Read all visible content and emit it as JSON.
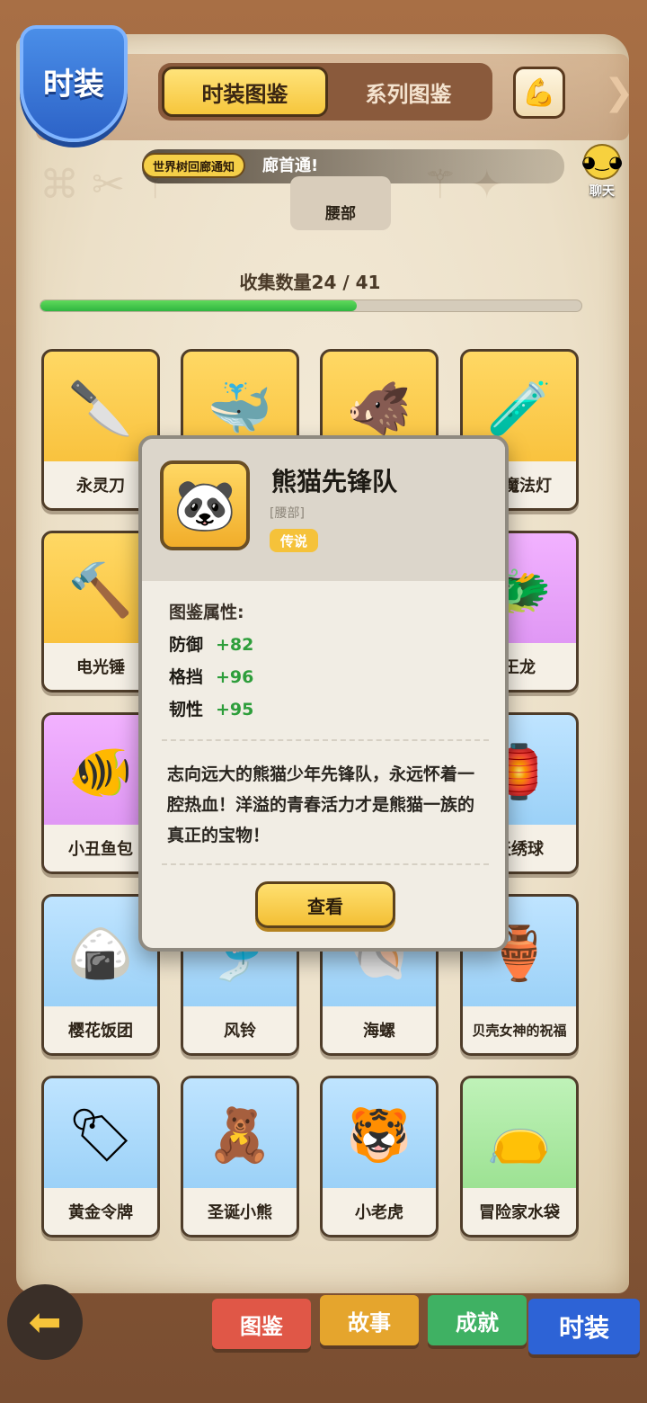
{
  "header": {
    "badge_title": "时装",
    "tabs": [
      {
        "label": "时装图鉴",
        "active": true
      },
      {
        "label": "系列图鉴",
        "active": false
      }
    ],
    "share_icon": "arm-flex-icon",
    "chevron_icon": "chevron-right-icon"
  },
  "notice": {
    "badge": "世界树回廊通知",
    "text": "廊首通!"
  },
  "category_chip": "腰部",
  "chat": {
    "label": "聊天",
    "icon": "chat-bubble-icon"
  },
  "collection": {
    "label": "收集数量24 / 41",
    "collected": 24,
    "total": 41
  },
  "grid": [
    {
      "name": "永灵刀",
      "rarity": "gold",
      "icon": "cleaver-icon"
    },
    {
      "name": "",
      "rarity": "gold",
      "icon": "whale-icon"
    },
    {
      "name": "",
      "rarity": "gold",
      "icon": "boar-icon"
    },
    {
      "name": "龙魔法灯",
      "rarity": "gold",
      "icon": "lamp-bottle-icon"
    },
    {
      "name": "电光锤",
      "rarity": "gold",
      "icon": "hammer-icon"
    },
    {
      "name": "王龙",
      "rarity": "purple",
      "icon": "red-dragon-icon"
    },
    {
      "name": "小丑鱼包",
      "rarity": "purple",
      "icon": "clownfish-icon"
    },
    {
      "name": "天绣球",
      "rarity": "blue",
      "icon": "embroidered-ball-icon"
    },
    {
      "name": "樱花饭团",
      "rarity": "blue",
      "icon": "rice-ball-icon"
    },
    {
      "name": "风铃",
      "rarity": "blue",
      "icon": "wind-chime-icon"
    },
    {
      "name": "海螺",
      "rarity": "blue",
      "icon": "conch-icon"
    },
    {
      "name": "贝壳女神的祝福",
      "rarity": "blue",
      "icon": "shell-goddess-icon"
    },
    {
      "name": "黄金令牌",
      "rarity": "blue",
      "icon": "gold-token-icon"
    },
    {
      "name": "圣诞小熊",
      "rarity": "blue",
      "icon": "christmas-bear-icon"
    },
    {
      "name": "小老虎",
      "rarity": "blue",
      "icon": "tiger-icon"
    },
    {
      "name": "冒险家水袋",
      "rarity": "green",
      "icon": "water-bag-icon"
    }
  ],
  "popup": {
    "title": "熊猫先锋队",
    "slot": "[腰部]",
    "rarity": "传说",
    "icon": "panda-flag-icon",
    "attr_title": "图鉴属性:",
    "attrs": [
      {
        "name": "防御",
        "value": "+82"
      },
      {
        "name": "格挡",
        "value": "+96"
      },
      {
        "name": "韧性",
        "value": "+95"
      }
    ],
    "description": "志向远大的熊猫少年先锋队，永远怀着一腔热血！洋溢的青春活力才是熊猫一族的真正的宝物！",
    "view_button": "查看"
  },
  "bottom_nav": {
    "back_icon": "back-arrow-icon",
    "tabs": [
      "图鉴",
      "故事",
      "成就",
      "时装"
    ]
  },
  "colors": {
    "gold": "#f6b92e",
    "purple": "#d88cf0",
    "blue": "#8cc9f4",
    "green": "#8edb83",
    "progress": "#2fb540"
  }
}
